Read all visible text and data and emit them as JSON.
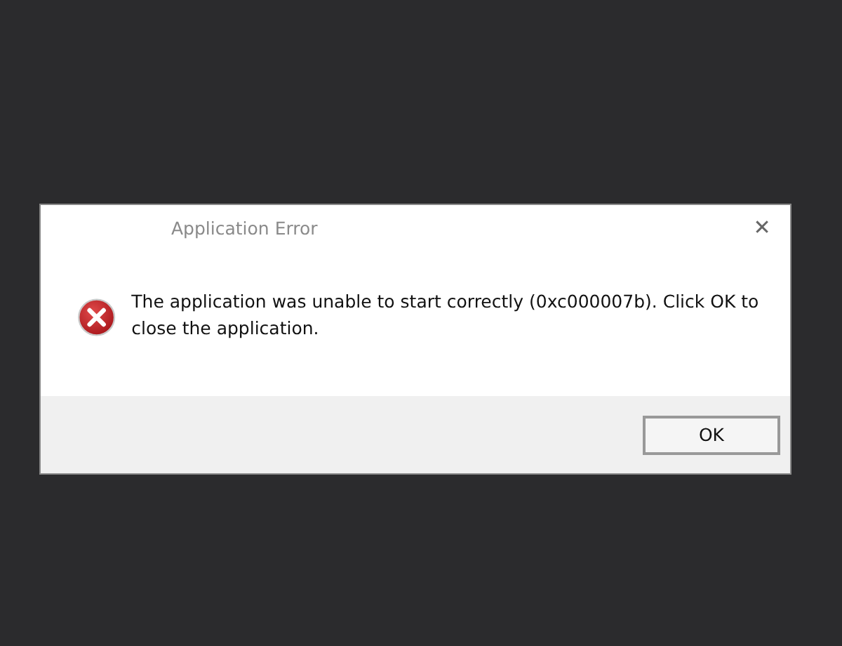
{
  "window": {
    "title": "Application Error",
    "close": "✕"
  },
  "message": "The application was unable to start correctly (0xc000007b). Click OK to close the application.",
  "buttons": [
    {
      "label": "OK",
      "default": true
    }
  ]
}
